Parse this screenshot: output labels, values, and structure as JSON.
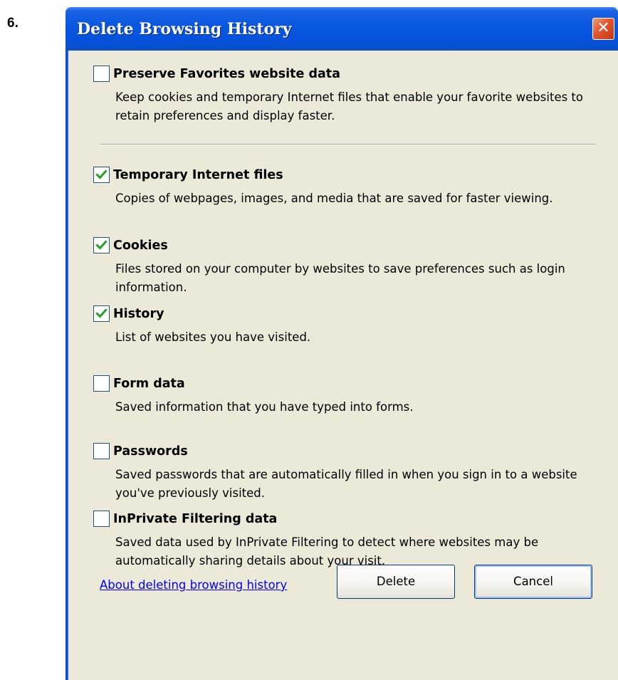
{
  "step_number": "6.",
  "dialog": {
    "title": "Delete Browsing History",
    "close_symbol": "✕"
  },
  "options": [
    {
      "label": "Preserve Favorites website data",
      "checked": false,
      "description": "Keep cookies and temporary Internet files that enable your favorite websites to retain preferences and display faster."
    },
    {
      "label": "Temporary Internet files",
      "checked": true,
      "description": "Copies of webpages, images, and media that are saved for faster viewing."
    },
    {
      "label": "Cookies",
      "checked": true,
      "description": "Files stored on your computer by websites to save preferences such as login information."
    },
    {
      "label": "History",
      "checked": true,
      "description": "List of websites you have visited."
    },
    {
      "label": "Form data",
      "checked": false,
      "description": "Saved information that you have typed into forms."
    },
    {
      "label": "Passwords",
      "checked": false,
      "description": "Saved passwords that are automatically filled in when you sign in to a website you've previously visited."
    },
    {
      "label": "InPrivate Filtering data",
      "checked": false,
      "description": "Saved data used by InPrivate Filtering to detect where websites may be automatically sharing details about your visit."
    }
  ],
  "footer": {
    "link_text": "About deleting browsing history",
    "delete_label": "Delete",
    "cancel_label": "Cancel"
  },
  "colors": {
    "title_bar": "#0a58e0",
    "dialog_background": "#ece9d8",
    "check_mark": "#21a121",
    "link": "#0000ff",
    "close_button": "#e2542c"
  }
}
